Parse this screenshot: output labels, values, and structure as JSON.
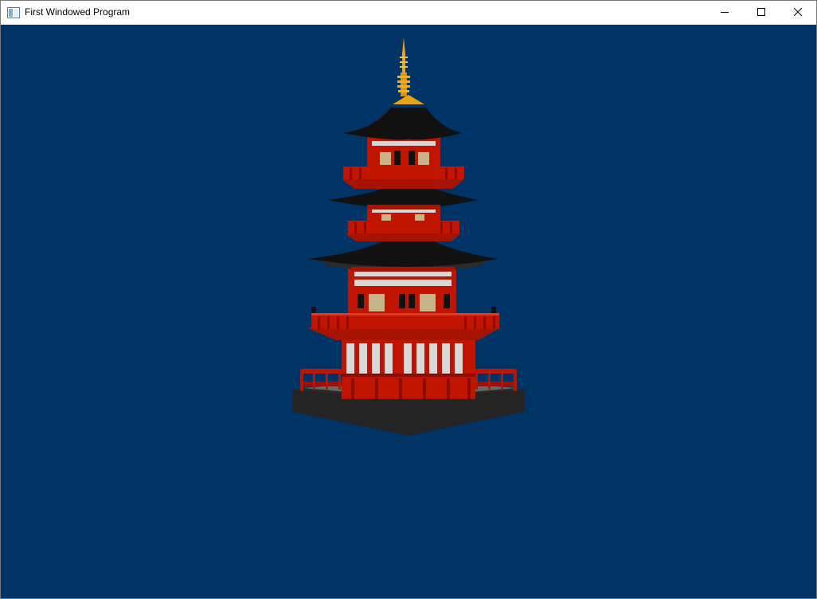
{
  "window": {
    "title": "First Windowed Program",
    "icon": "app-window-icon",
    "controls": {
      "minimize_icon": "minimize-icon",
      "maximize_icon": "maximize-icon",
      "close_icon": "close-icon"
    }
  },
  "viewport": {
    "clear_color": "#003366",
    "scene": "pagoda-3d-model",
    "model_colors": {
      "roof": "#111111",
      "body": "#c01500",
      "wall": "#d8d8d8",
      "spire": "#e8a317",
      "base": "#2a2a2a"
    }
  }
}
